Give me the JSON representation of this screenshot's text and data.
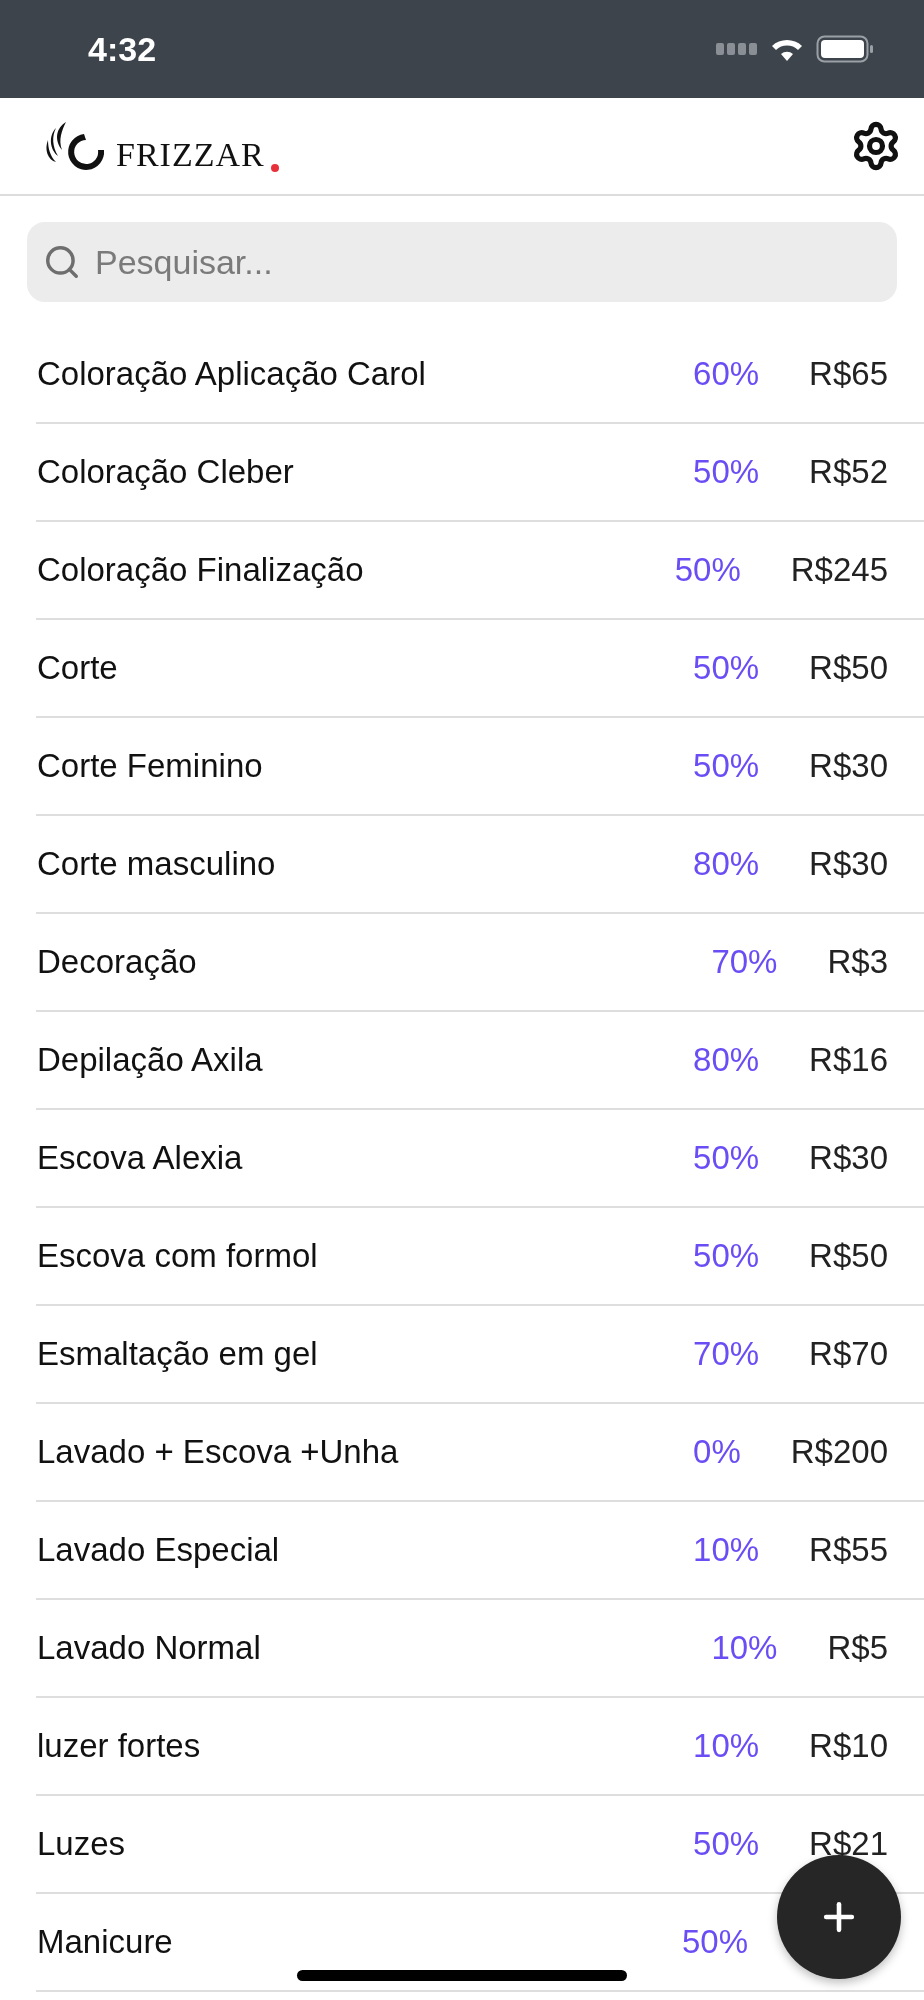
{
  "status_bar": {
    "time": "4:32"
  },
  "header": {
    "logo_text": "FRIZZAR"
  },
  "search": {
    "placeholder": "Pesquisar..."
  },
  "services": [
    {
      "name": "Coloração Aplicação Carol",
      "commission": "60%",
      "price": "R$65"
    },
    {
      "name": "Coloração Cleber",
      "commission": "50%",
      "price": "R$52"
    },
    {
      "name": "Coloração Finalização",
      "commission": "50%",
      "price": "R$245"
    },
    {
      "name": "Corte",
      "commission": "50%",
      "price": "R$50"
    },
    {
      "name": "Corte Feminino",
      "commission": "50%",
      "price": "R$30"
    },
    {
      "name": "Corte masculino",
      "commission": "80%",
      "price": "R$30"
    },
    {
      "name": "Decoração",
      "commission": "70%",
      "price": "R$3"
    },
    {
      "name": "Depilação Axila",
      "commission": "80%",
      "price": "R$16"
    },
    {
      "name": "Escova Alexia",
      "commission": "50%",
      "price": "R$30"
    },
    {
      "name": "Escova com formol",
      "commission": "50%",
      "price": "R$50"
    },
    {
      "name": "Esmaltação em gel",
      "commission": "70%",
      "price": "R$70"
    },
    {
      "name": "Lavado + Escova +Unha",
      "commission": "0%",
      "price": "R$200"
    },
    {
      "name": "Lavado Especial",
      "commission": "10%",
      "price": "R$55"
    },
    {
      "name": "Lavado Normal",
      "commission": "10%",
      "price": "R$5"
    },
    {
      "name": "luzer fortes",
      "commission": "10%",
      "price": "R$10"
    },
    {
      "name": "Luzes",
      "commission": "50%",
      "price": "R$21"
    },
    {
      "name": "Manicure",
      "commission": "50%"
    }
  ]
}
